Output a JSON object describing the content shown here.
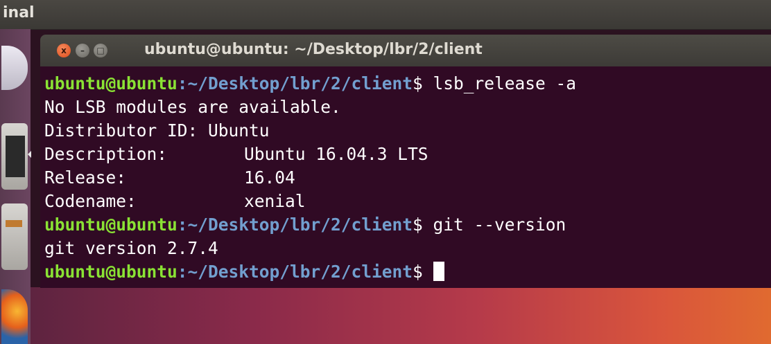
{
  "top_panel": {
    "title": "inal"
  },
  "window": {
    "title": "ubuntu@ubuntu: ~/Desktop/lbr/2/client",
    "buttons": {
      "close": "x",
      "minimize": "–",
      "maximize": "□"
    }
  },
  "terminal": {
    "prompt_user": "ubuntu@ubuntu",
    "prompt_path": ":~/Desktop/lbr/2/client",
    "prompt_symbol": "$ ",
    "commands": {
      "lsb": "lsb_release -a",
      "git": "git --version"
    },
    "output": {
      "no_lsb": "No LSB modules are available.",
      "distributor_key": "Distributor ID:",
      "distributor_val": "Ubuntu",
      "description_key": "Description:",
      "description_val": "Ubuntu 16.04.3 LTS",
      "release_key": "Release:",
      "release_val": "16.04",
      "codename_key": "Codename:",
      "codename_val": "xenial",
      "git_version": "git version 2.7.4"
    }
  },
  "colors": {
    "terminal_bg": "#300a24",
    "prompt_user": "#8ae234",
    "prompt_path": "#729fcf",
    "text": "#ffffff"
  }
}
